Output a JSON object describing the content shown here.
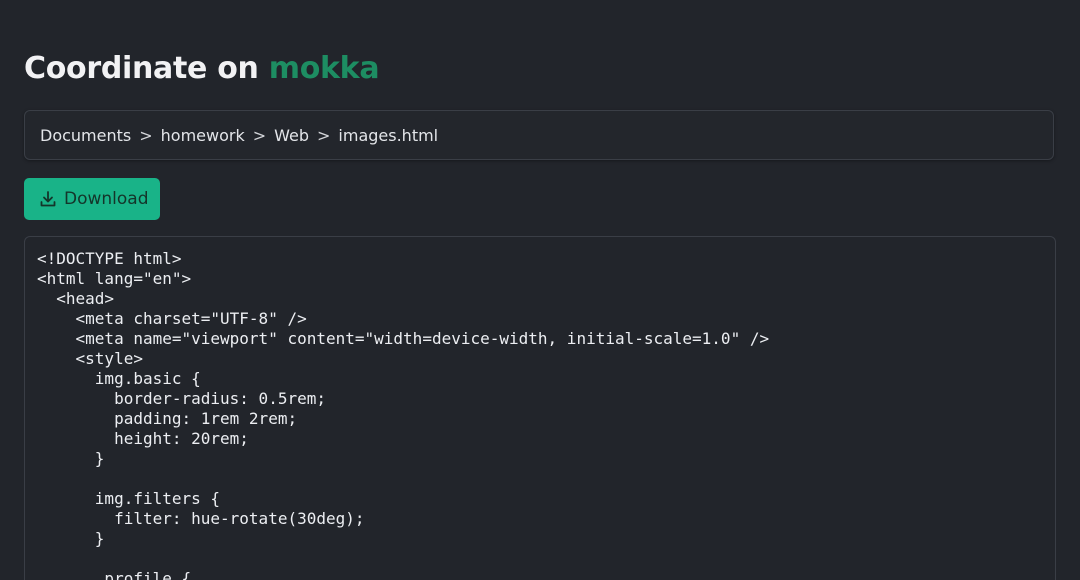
{
  "header": {
    "title_prefix": "Coordinate on ",
    "title_accent": "mokka",
    "accent_color": "#1d8d62"
  },
  "breadcrumb": {
    "items": [
      "Documents",
      "homework",
      "Web",
      "images.html"
    ],
    "separator": ">"
  },
  "toolbar": {
    "download_label": "Download",
    "download_icon": "download-icon",
    "button_color": "#19b388"
  },
  "code": {
    "lines": [
      "<!DOCTYPE html>",
      "<html lang=\"en\">",
      "  <head>",
      "    <meta charset=\"UTF-8\" />",
      "    <meta name=\"viewport\" content=\"width=device-width, initial-scale=1.0\" />",
      "    <style>",
      "      img.basic {",
      "        border-radius: 0.5rem;",
      "        padding: 1rem 2rem;",
      "        height: 20rem;",
      "      }",
      "",
      "      img.filters {",
      "        filter: hue-rotate(30deg);",
      "      }",
      "",
      "      .profile {"
    ]
  }
}
